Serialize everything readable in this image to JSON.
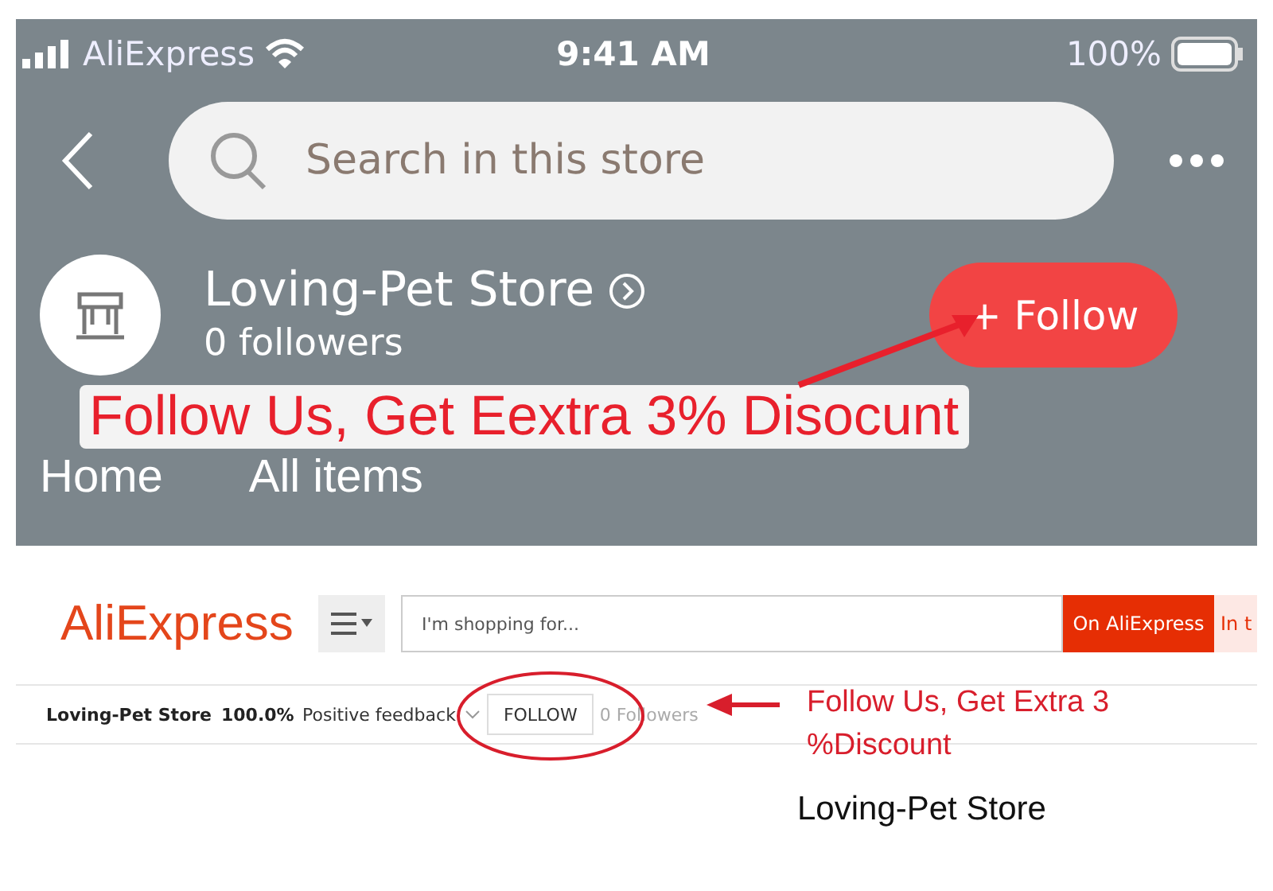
{
  "mobile_store_page": {
    "status_bar": {
      "carrier": "AliExpress",
      "time": "9:41 AM",
      "battery": "100%"
    },
    "search": {
      "placeholder": "Search in this store"
    },
    "store_name": "Loving-Pet Store",
    "followers": "0 followers",
    "follow_button": "+ Follow",
    "tabs": [
      "Home",
      "All items"
    ]
  },
  "annotation_top": "Follow Us, Get Eextra 3% Disocunt",
  "web_header": {
    "logo": "AliExpress",
    "search": {
      "placeholder": "I'm shopping for..."
    },
    "buttons": [
      {
        "label": "On AliExpress",
        "kind": "primary"
      },
      {
        "label": "In t",
        "kind": "secondary"
      }
    ]
  },
  "store_bar": {
    "store_name": "Loving-Pet Store",
    "rating": "100.0%",
    "rating_label": "Positive feedback",
    "follow_button": "FOLLOW",
    "followers": "0 Followers"
  },
  "annotation_bottom": "Follow Us, Get Extra 3 %Discount",
  "caption": "Loving-Pet Store"
}
